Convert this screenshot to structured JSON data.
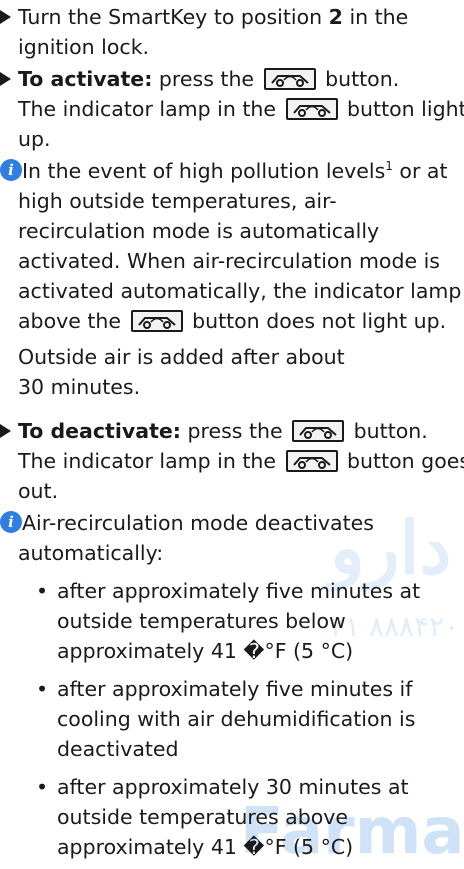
{
  "watermarks": {
    "arabic": "دارو",
    "digits": "۲۱ ۸۸۸۴۲۰",
    "brand": "FarmaSo"
  },
  "steps": {
    "step1_line1": "Turn the SmartKey to position ",
    "step1_bold": "2",
    "step1_line1_end": " in the",
    "step1_line2": "ignition lock.",
    "activate_label": "To activate:",
    "activate_text": " press the ",
    "activate_end": " button.",
    "activate_l2a": "The indicator lamp in the ",
    "activate_l2b": " button lights",
    "activate_l3": "up.",
    "deactivate_label": "To deactivate:",
    "deactivate_text": " press the ",
    "deactivate_end": " button.",
    "deactivate_l2a": "The indicator lamp in the ",
    "deactivate_l2b": " button goes",
    "deactivate_l3": "out."
  },
  "note1": {
    "l1a": " In the event of high pollution levels",
    "footnote": "1",
    "l1b": " or at",
    "l2": "high outside temperatures, air-",
    "l3": "recirculation mode is automatically",
    "l4": "activated. When air-recirculation mode is",
    "l5": "activated automatically, the indicator lamp",
    "l6a": "above the ",
    "l6b": " button does not light up.",
    "p2l1": "Outside air is added after about",
    "p2l2": "30 minutes."
  },
  "note2": {
    "l1": " Air-recirculation mode deactivates",
    "l2": "automatically:",
    "b1l1": "after approximately five minutes at",
    "b1l2": "outside temperatures below",
    "b1l3": "approximately 41 �°F (5 °C)",
    "b2l1": "after approximately five minutes if",
    "b2l2": "cooling with air dehumidification is",
    "b2l3": "deactivated",
    "b3l1": "after approximately 30 minutes at",
    "b3l2": "outside temperatures above",
    "b3l3": "approximately 41 �°F (5 °C)"
  },
  "icons": {
    "button_icon": "air-recirculation-icon",
    "info_icon": "info-icon",
    "step_icon": "triangle-bullet-icon"
  }
}
